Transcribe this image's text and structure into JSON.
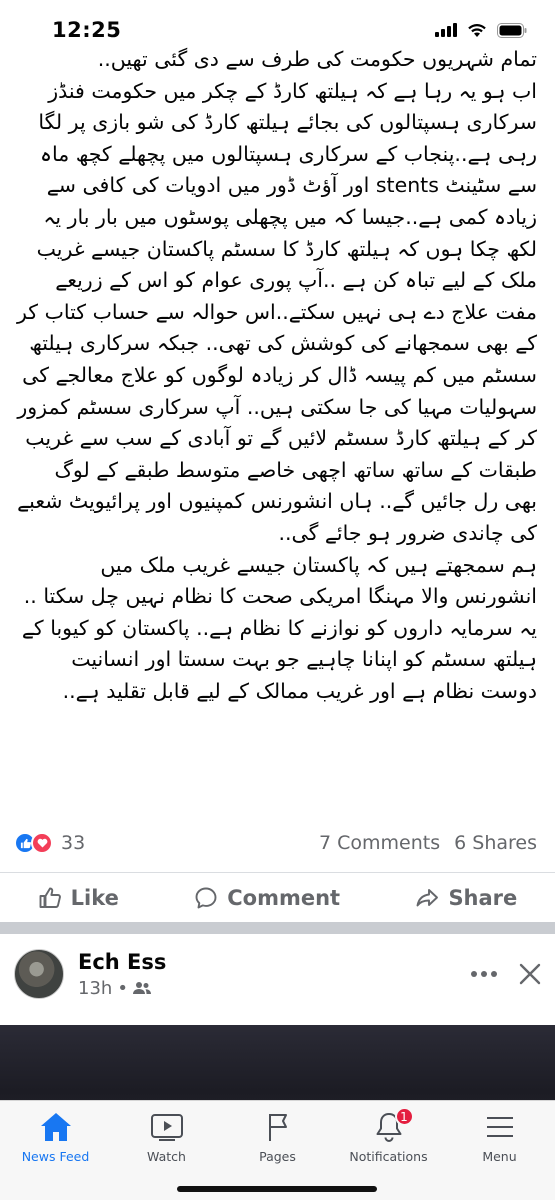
{
  "status_bar": {
    "time": "12:25"
  },
  "post": {
    "paragraphs": [
      "تمام شہریوں حکومت کی طرف سے دی گئی تھیں..",
      "اب ہو یہ رہا ہے کہ ہیلتھ کارڈ کے چکر میں حکومت فنڈز سرکاری ہسپتالوں کی بجائے ہیلتھ کارڈ کی شو بازی پر لگا رہی ہے..پنجاب کے سرکاری ہسپتالوں میں پچھلے کچھ ماہ سے سٹینٹ stents اور آؤٹ ڈور میں ادویات کی کافی سے زیادہ کمی ہے..جیسا کہ میں پچھلی پوسٹوں میں بار بار یہ لکھ چکا ہوں کہ ہیلتھ کارڈ کا سسٹم پاکستان جیسے غریب ملک کے لیے تباہ کن ہے ..آپ پوری عوام کو اس کے زریعے مفت علاج دے ہی نہیں سکتے..اس حوالہ سے حساب کتاب کر کے بھی سمجھانے کی کوشش کی تھی.. جبکہ سرکاری ہیلتھ سسٹم میں کم پیسہ ڈال کر زیادہ لوگوں کو علاج معالجے کی سہولیات مہیا کی جا سکتی ہیں.. آپ سرکاری سسٹم کمزور کر کے ہیلتھ کارڈ سسٹم لائیں گے تو آبادی کے سب سے غریب طبقات کے ساتھ ساتھ اچھی خاصے متوسط طبقے کے لوگ بھی رل جائیں گے.. ہاں انشورنس کمپنیوں اور پرائیویٹ شعبے کی چاندی ضرور ہو جائے گی..",
      "ہم سمجھتے ہیں کہ پاکستان جیسے غریب ملک میں انشورنس والا مہنگا امریکی صحت کا نظام نہیں چل سکتا .. یہ سرمایہ داروں کو نوازنے کا نظام ہے.. پاکستان کو کیوبا کے ہیلتھ سسٹم کو اپنانا چاہیے جو بہت سستا اور انسانیت دوست نظام ہے اور غریب ممالک کے لیے قابل تقلید ہے.."
    ],
    "reaction_count": "33",
    "comments_count": "7 Comments",
    "shares_count": "6 Shares"
  },
  "actions": {
    "like": "Like",
    "comment": "Comment",
    "share": "Share"
  },
  "next_post": {
    "author": "Ech Ess",
    "time": "13h",
    "separator": "•"
  },
  "nav": {
    "items": [
      {
        "label": "News Feed"
      },
      {
        "label": "Watch"
      },
      {
        "label": "Pages"
      },
      {
        "label": "Notifications",
        "badge": "1"
      },
      {
        "label": "Menu"
      }
    ]
  },
  "colors": {
    "accent": "#1877f2",
    "love": "#f33e58",
    "badge": "#e41e3f",
    "secondary_text": "#65676b"
  }
}
